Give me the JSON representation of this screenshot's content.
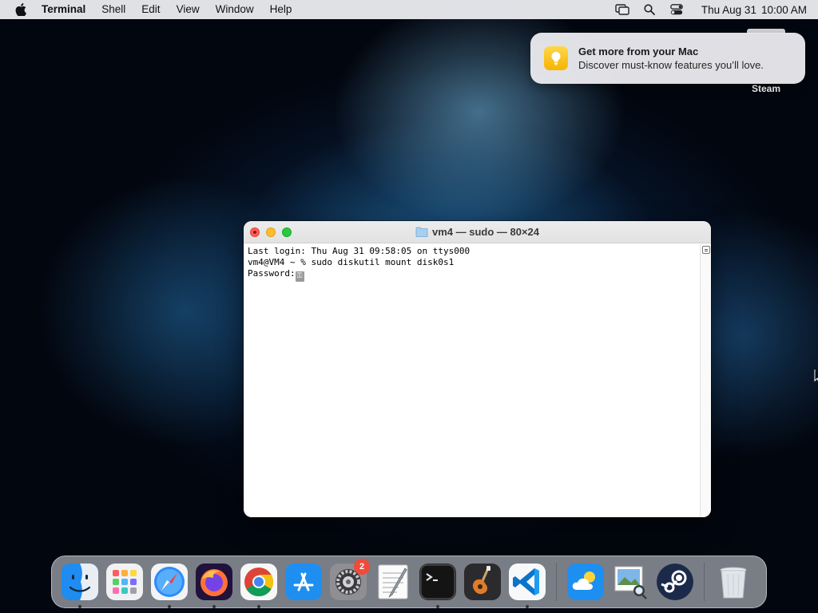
{
  "menubar": {
    "app_name": "Terminal",
    "items": [
      "Shell",
      "Edit",
      "View",
      "Window",
      "Help"
    ],
    "date": "Thu Aug 31",
    "time": "10:00 AM"
  },
  "notification": {
    "title": "Get more from your Mac",
    "body": "Discover must-know features you’ll love."
  },
  "desktop": {
    "icon_label": "Steam"
  },
  "terminal": {
    "title": "vm4 — sudo — 80×24",
    "lines": [
      "Last login: Thu Aug 31 09:58:05 on ttys000",
      "vm4@VM4 ~ % sudo diskutil mount disk0s1",
      "Password:"
    ],
    "cursor_glyph": "⚿"
  },
  "dock": {
    "settings_badge": "2",
    "items": [
      "finder-icon",
      "launchpad-icon",
      "safari-icon",
      "firefox-icon",
      "chrome-icon",
      "app-store-icon",
      "system-settings-icon",
      "textedit-icon",
      "terminal-icon",
      "garageband-icon",
      "vscode-icon",
      "weather-icon",
      "preview-icon",
      "steam-icon",
      "trash-icon"
    ]
  },
  "colors": {
    "menubar_bg": "#e8eaee",
    "close": "#fe5f57",
    "minimize": "#febc2e",
    "maximize": "#28c840",
    "badge": "#f04a3a"
  }
}
